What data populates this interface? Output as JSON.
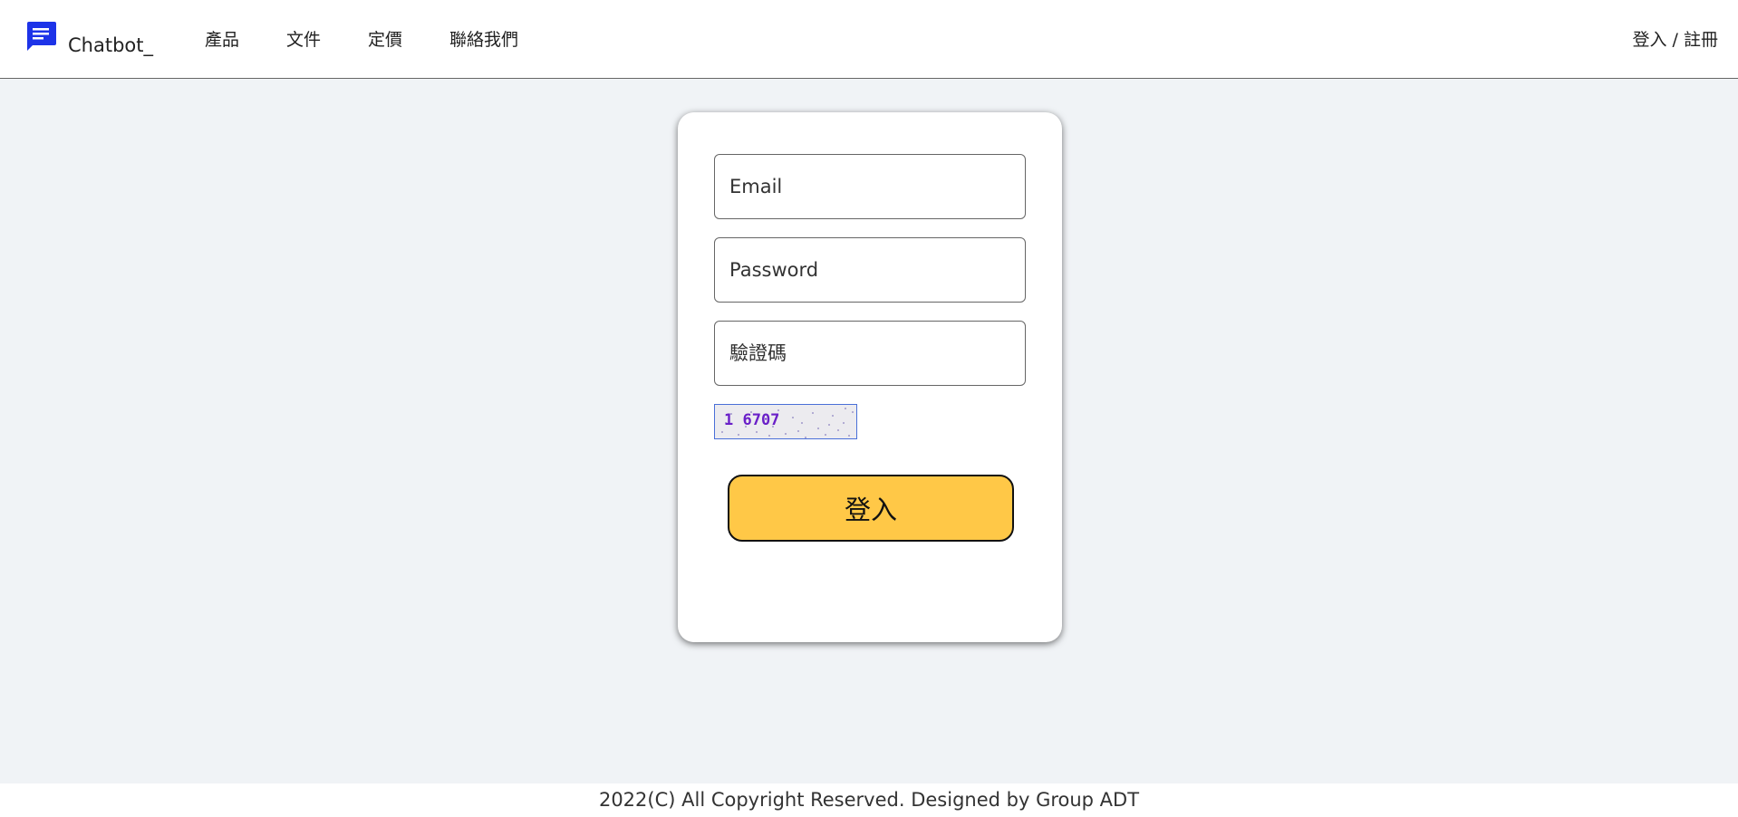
{
  "header": {
    "brand": "Chatbot_",
    "logo_icon": "chat-message-icon",
    "logo_color": "#1d33e8",
    "nav": [
      {
        "label": "產品"
      },
      {
        "label": "文件"
      },
      {
        "label": "定價"
      },
      {
        "label": "聯絡我們"
      }
    ],
    "auth_link": "登入 / 註冊"
  },
  "login_form": {
    "email_placeholder": "Email",
    "password_placeholder": "Password",
    "captcha_placeholder": "驗證碼",
    "captcha_text": "1 6707",
    "submit_label": "登入",
    "submit_color": "#ffc847"
  },
  "footer": {
    "text": "2022(C) All Copyright Reserved. Designed by Group ADT"
  }
}
